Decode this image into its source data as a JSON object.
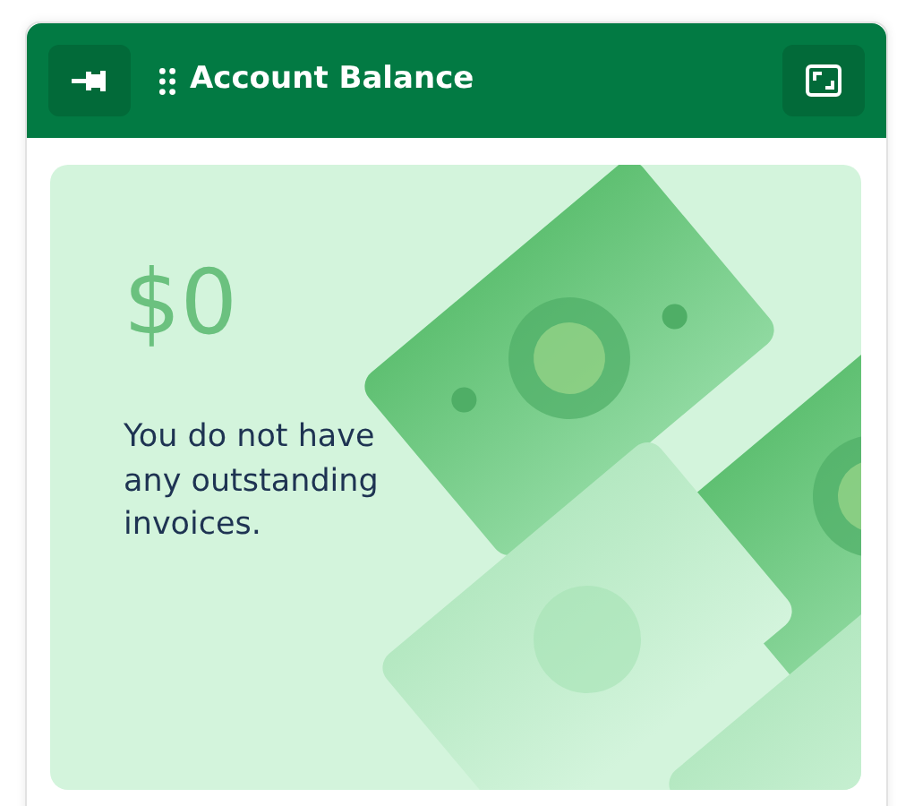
{
  "header": {
    "title": "Account Balance"
  },
  "balance": {
    "amount": "$0",
    "message": "You do not have any outstanding invoices."
  }
}
